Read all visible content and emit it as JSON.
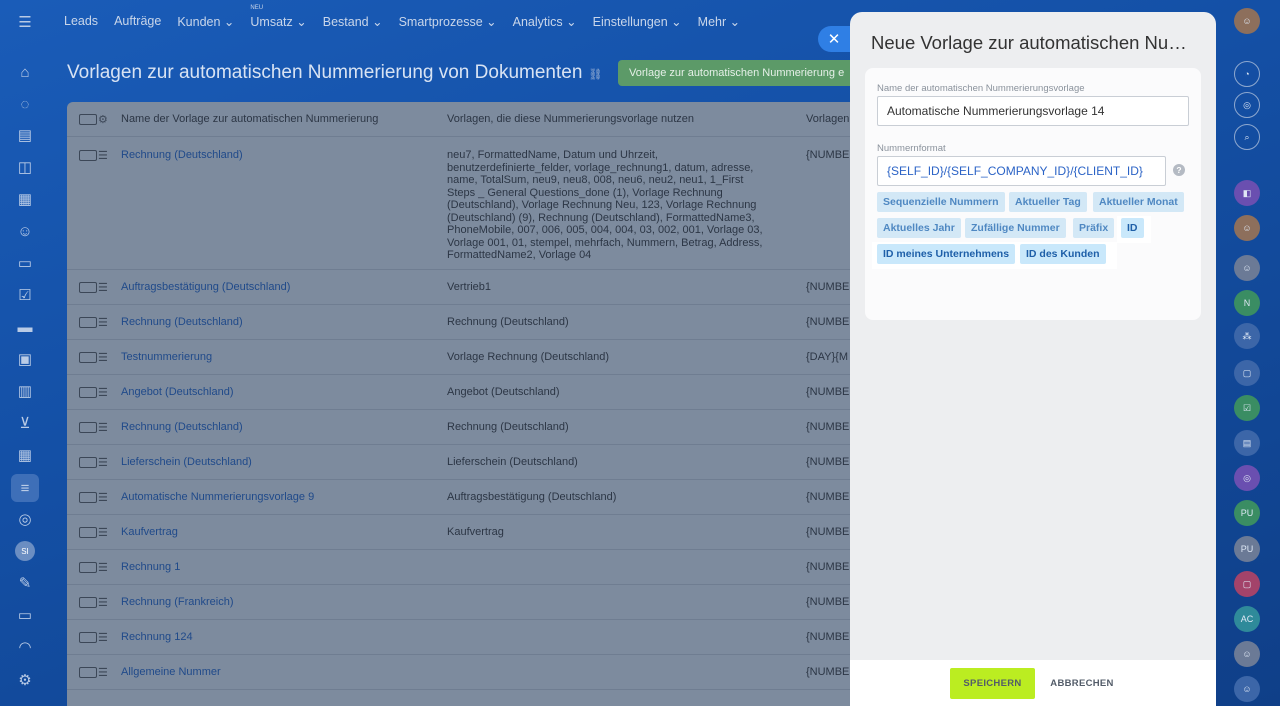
{
  "nav": {
    "items": [
      "Leads",
      "Aufträge",
      "Kunden",
      "Umsatz",
      "Bestand",
      "Smartprozesse",
      "Analytics",
      "Einstellungen",
      "Mehr"
    ],
    "new_badge": "NEU"
  },
  "page": {
    "title": "Vorlagen zur automatischen Nummerierung von Dokumenten",
    "add_button": "Vorlage zur automatischen Nummerierung e"
  },
  "grid": {
    "headers": {
      "name": "Name der Vorlage zur automatischen Nummerierung",
      "uses": "Vorlagen, die diese Nummerierungsvorlage nutzen",
      "format": "Vorlagen"
    },
    "rows": [
      {
        "name": "Rechnung (Deutschland)",
        "uses": "neu7, FormattedName, Datum und Uhrzeit, benutzerdefinierte_felder, vorlage_rechnung1, datum, adresse, name, TotalSum, neu9, neu8, 008, neu6, neu2, neu1, 1_First Steps _ General Questions_done (1), Vorlage Rechnung (Deutschland), Vorlage Rechnung Neu, 123, Vorlage Rechnung (Deutschland) (9), Rechnung (Deutschland), FormattedName3, PhoneMobile, 007, 006, 005, 004, 004, 03, 002, 001, Vorlage 03, Vorlage 001, 01, stempel, mehrfach, Nummern, Betrag, Address, FormattedName2, Vorlage 04",
        "format": "{NUMBEI"
      },
      {
        "name": "Auftragsbestätigung (Deutschland)",
        "uses": "Vertrieb1",
        "format": "{NUMBEI"
      },
      {
        "name": "Rechnung (Deutschland)",
        "uses": "Rechnung (Deutschland)",
        "format": "{NUMBEI"
      },
      {
        "name": "Testnummerierung",
        "uses": "Vorlage Rechnung (Deutschland)",
        "format": "{DAY}{M"
      },
      {
        "name": "Angebot (Deutschland)",
        "uses": "Angebot (Deutschland)",
        "format": "{NUMBEI"
      },
      {
        "name": "Rechnung (Deutschland)",
        "uses": "Rechnung (Deutschland)",
        "format": "{NUMBEI"
      },
      {
        "name": "Lieferschein (Deutschland)",
        "uses": "Lieferschein (Deutschland)",
        "format": "{NUMBEI"
      },
      {
        "name": "Automatische Nummerierungsvorlage 9",
        "uses": "Auftragsbestätigung (Deutschland)",
        "format": "{NUMBEI"
      },
      {
        "name": "Kaufvertrag",
        "uses": "Kaufvertrag",
        "format": "{NUMBEI"
      },
      {
        "name": "Rechnung 1",
        "uses": "",
        "format": "{NUMBEI"
      },
      {
        "name": "Rechnung (Frankreich)",
        "uses": "",
        "format": "{NUMBEI"
      },
      {
        "name": "Rechnung 124",
        "uses": "",
        "format": "{NUMBEI"
      },
      {
        "name": "Allgemeine Nummer",
        "uses": "",
        "format": "{NUMBEI"
      }
    ]
  },
  "panel": {
    "title": "Neue Vorlage zur automatischen Nummerierung",
    "name_label": "Name der automatischen Nummerierungsvorlage",
    "name_value": "Automatische Nummerierungsvorlage  14",
    "format_label": "Nummernformat",
    "format_value": "{SELF_ID}/{SELF_COMPANY_ID}/{CLIENT_ID}",
    "chips": [
      "Sequenzielle Nummern",
      "Aktueller Tag",
      "Aktueller Monat",
      "Aktuelles Jahr",
      "Zufällige Nummer",
      "Präfix",
      "ID",
      "ID meines Unternehmens",
      "ID des Kunden"
    ],
    "save": "SPEICHERN",
    "cancel": "ABBRECHEN"
  },
  "rails": {
    "left_badge": "SI",
    "right_badges": [
      "N",
      "PU",
      "PU",
      "AC"
    ]
  },
  "colors": {
    "accent_blue": "#2f7fe5",
    "save_green": "#bbed21",
    "chip_bg": "#d3e8f6"
  }
}
